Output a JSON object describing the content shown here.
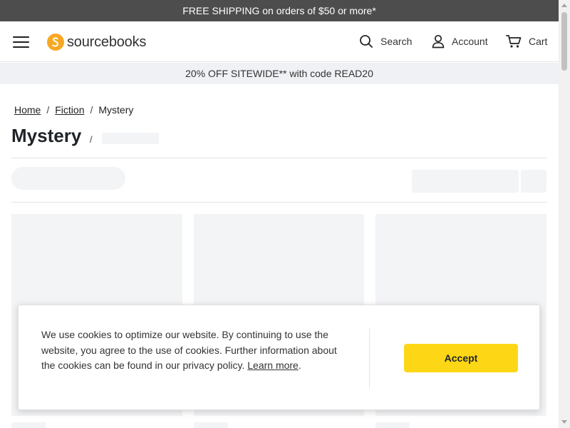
{
  "promo_top": {
    "text": "FREE SHIPPING on orders of $50 or more*"
  },
  "header": {
    "menu_icon": "hamburger-icon",
    "logo": {
      "text": "sourcebooks",
      "color": "#f7a823"
    },
    "search_label": "Search",
    "account_label": "Account",
    "cart_label": "Cart"
  },
  "promo_bar": {
    "text": "20% OFF SITEWIDE** with code READ20"
  },
  "breadcrumb": {
    "items": [
      {
        "label": "Home"
      },
      {
        "label": "Fiction"
      },
      {
        "label": "Mystery"
      }
    ],
    "separator": "/"
  },
  "page": {
    "title": "Mystery",
    "title_separator": "/"
  },
  "cookie_banner": {
    "text": "We use cookies to optimize our website. By continuing to use the website, you agree to the use of cookies. Further information about the cookies can be found in our privacy policy.",
    "text_before_link": "We use cookies to optimize our website. By continuing to use the website, you agree to the use of cookies. Further information about the cookies can be found in our privacy policy. ",
    "link_label": "Learn more",
    "text_after_link": ".",
    "accept_label": "Accept",
    "accept_color": "#fdd716"
  },
  "colors": {
    "top_bar": "#4d4d4d",
    "promo_bar": "#eff1f4",
    "skeleton": "#f3f4f6"
  }
}
